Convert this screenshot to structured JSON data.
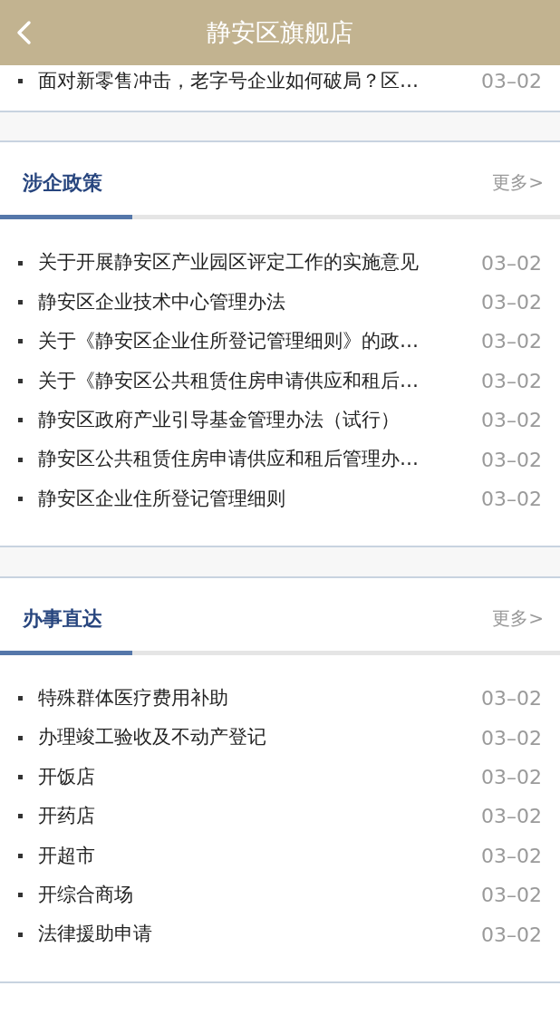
{
  "header": {
    "title": "静安区旗舰店"
  },
  "top_item": {
    "title": "面对新零售冲击，老字号企业如何破局？区…",
    "date": "03–02"
  },
  "sections": [
    {
      "title": "涉企政策",
      "more": "更多>",
      "items": [
        {
          "title": "关于开展静安区产业园区评定工作的实施意见",
          "date": "03–02"
        },
        {
          "title": "静安区企业技术中心管理办法",
          "date": "03–02"
        },
        {
          "title": "关于《静安区企业住所登记管理细则》的政…",
          "date": "03–02"
        },
        {
          "title": "关于《静安区公共租赁住房申请供应和租后…",
          "date": "03–02"
        },
        {
          "title": "静安区政府产业引导基金管理办法（试行）",
          "date": "03–02"
        },
        {
          "title": "静安区公共租赁住房申请供应和租后管理办…",
          "date": "03–02"
        },
        {
          "title": "静安区企业住所登记管理细则",
          "date": "03–02"
        }
      ]
    },
    {
      "title": "办事直达",
      "more": "更多>",
      "items": [
        {
          "title": "特殊群体医疗费用补助",
          "date": "03–02"
        },
        {
          "title": "办理竣工验收及不动产登记",
          "date": "03–02"
        },
        {
          "title": "开饭店",
          "date": "03–02"
        },
        {
          "title": "开药店",
          "date": "03–02"
        },
        {
          "title": "开超市",
          "date": "03–02"
        },
        {
          "title": "开综合商场",
          "date": "03–02"
        },
        {
          "title": "法律援助申请",
          "date": "03–02"
        }
      ]
    }
  ]
}
